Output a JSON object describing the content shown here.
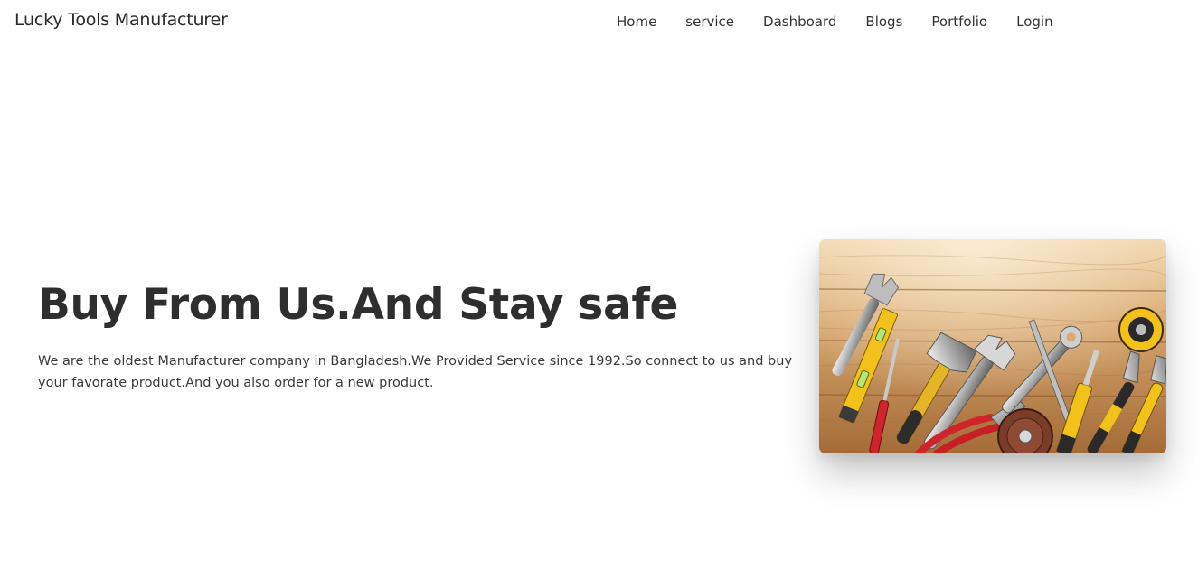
{
  "brand": "Lucky Tools Manufacturer",
  "nav": {
    "items": [
      {
        "label": "Home"
      },
      {
        "label": "service"
      },
      {
        "label": "Dashboard"
      },
      {
        "label": "Blogs"
      },
      {
        "label": "Portfolio"
      },
      {
        "label": "Login"
      }
    ]
  },
  "hero": {
    "title": "Buy From Us.And Stay safe",
    "description": "We are the oldest Manufacturer company in Bangladesh.We Provided Service since 1992.So connect to us and buy your favorate product.And you also order for a new product.",
    "image_icon": "tools-on-wooden-table-photo"
  },
  "colors": {
    "text": "#333333",
    "wood_light": "#e7c497",
    "wood_dark": "#b07a45",
    "tool_yellow": "#f2c21b",
    "tool_red": "#d0232a"
  }
}
